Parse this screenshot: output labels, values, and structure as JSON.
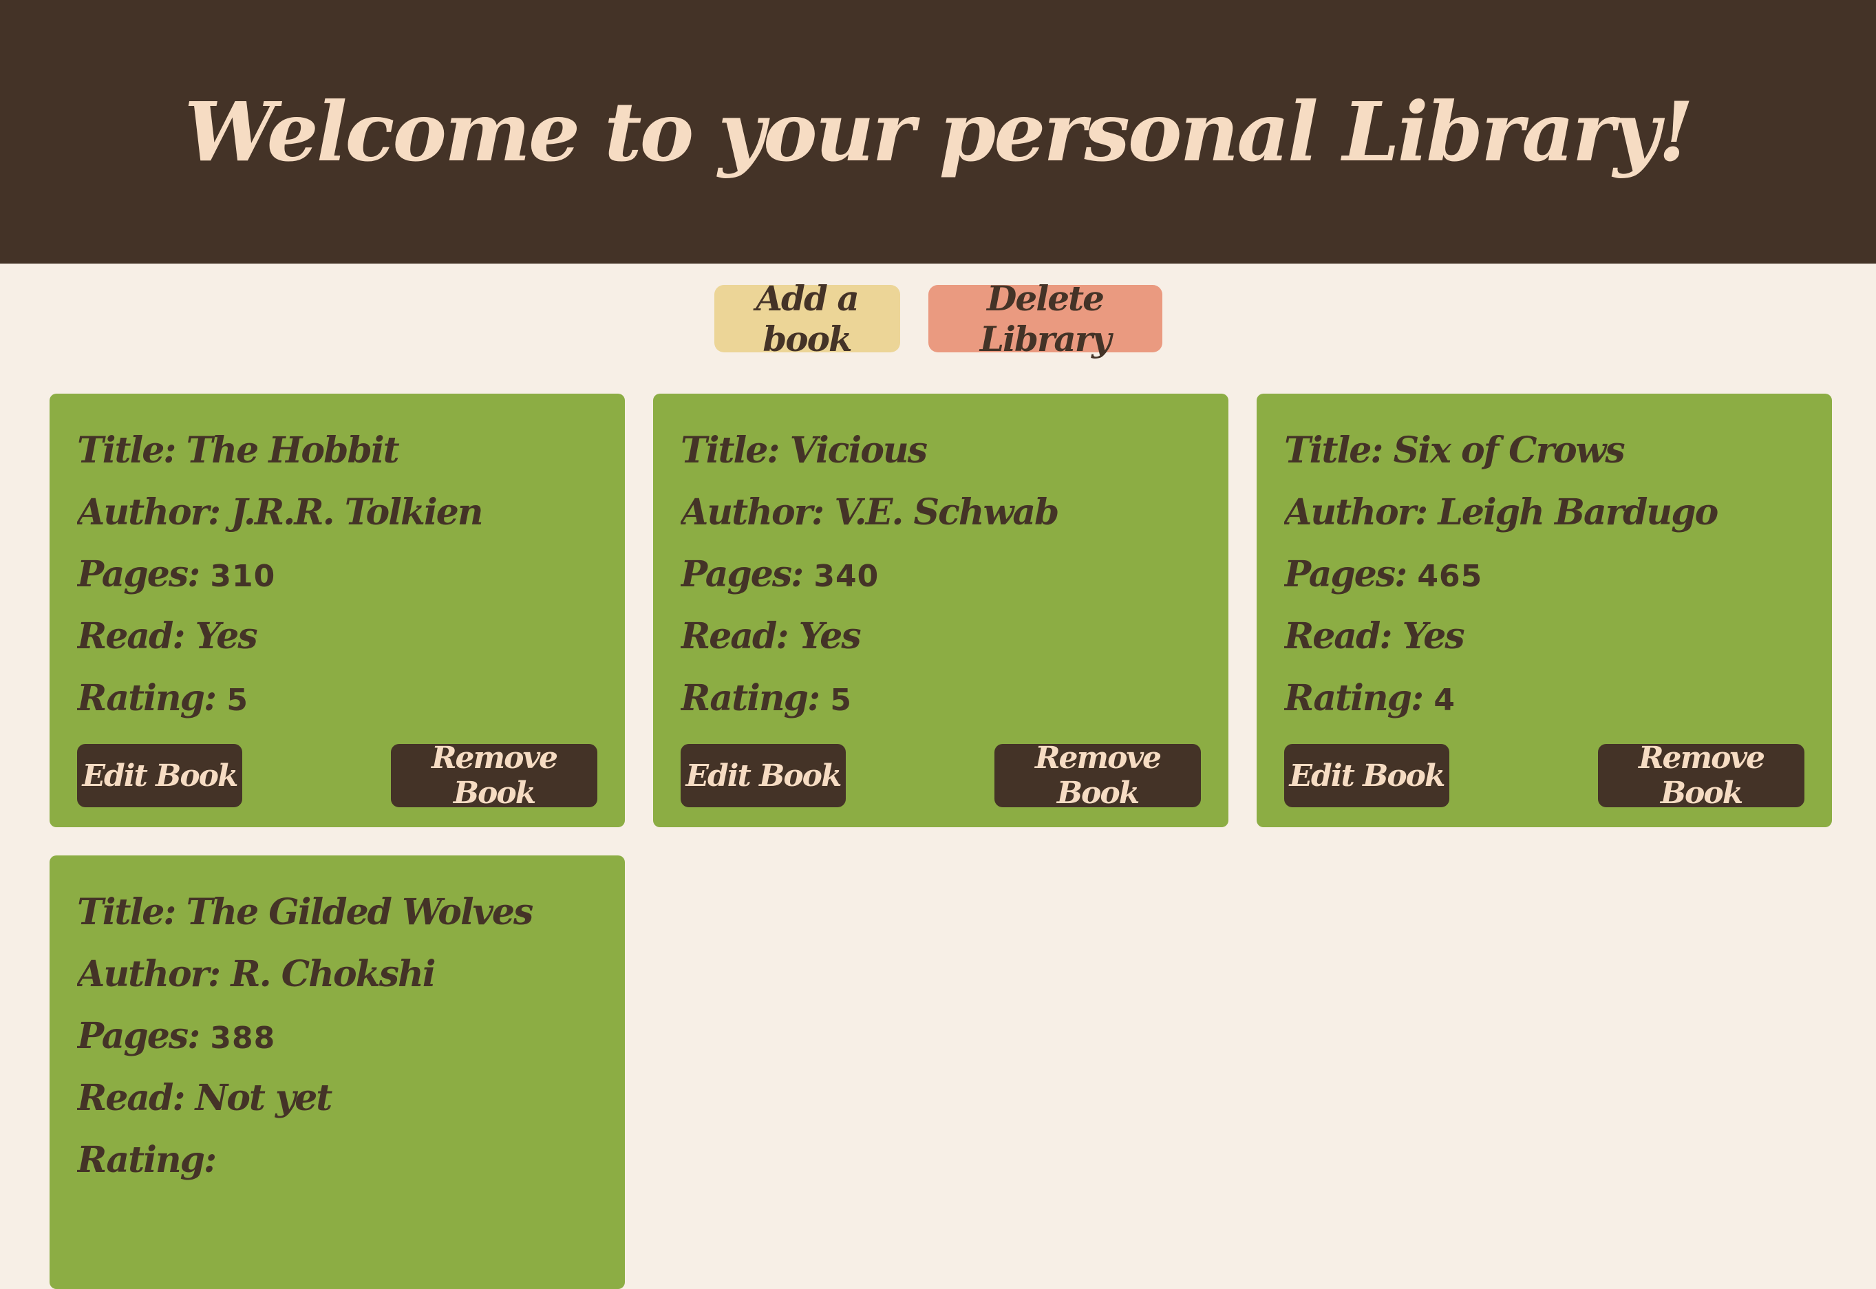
{
  "header": {
    "title": "Welcome to your personal Library!"
  },
  "controls": {
    "add_label": "Add a book",
    "delete_label": "Delete Library"
  },
  "labels": {
    "title": "Title: ",
    "author": "Author: ",
    "pages": "Pages: ",
    "read": "Read: ",
    "rating": "Rating: ",
    "edit": "Edit Book",
    "remove": "Remove Book"
  },
  "books": [
    {
      "title": "The Hobbit",
      "author": "J.R.R. Tolkien",
      "pages": "310",
      "read": "Yes",
      "rating": "5"
    },
    {
      "title": "Vicious",
      "author": "V.E. Schwab",
      "pages": "340",
      "read": "Yes",
      "rating": "5"
    },
    {
      "title": "Six of Crows",
      "author": "Leigh Bardugo",
      "pages": "465",
      "read": "Yes",
      "rating": "4"
    },
    {
      "title": "The Gilded Wolves",
      "author": "R. Chokshi",
      "pages": "388",
      "read": "Not yet",
      "rating": ""
    }
  ],
  "colors": {
    "header_bg": "#443327",
    "page_bg": "#f7efe6",
    "card_bg": "#8cad44",
    "add_button": "#ecd597",
    "delete_button": "#ea9a80",
    "text_dark": "#443327",
    "text_light": "#f6dcc3"
  }
}
